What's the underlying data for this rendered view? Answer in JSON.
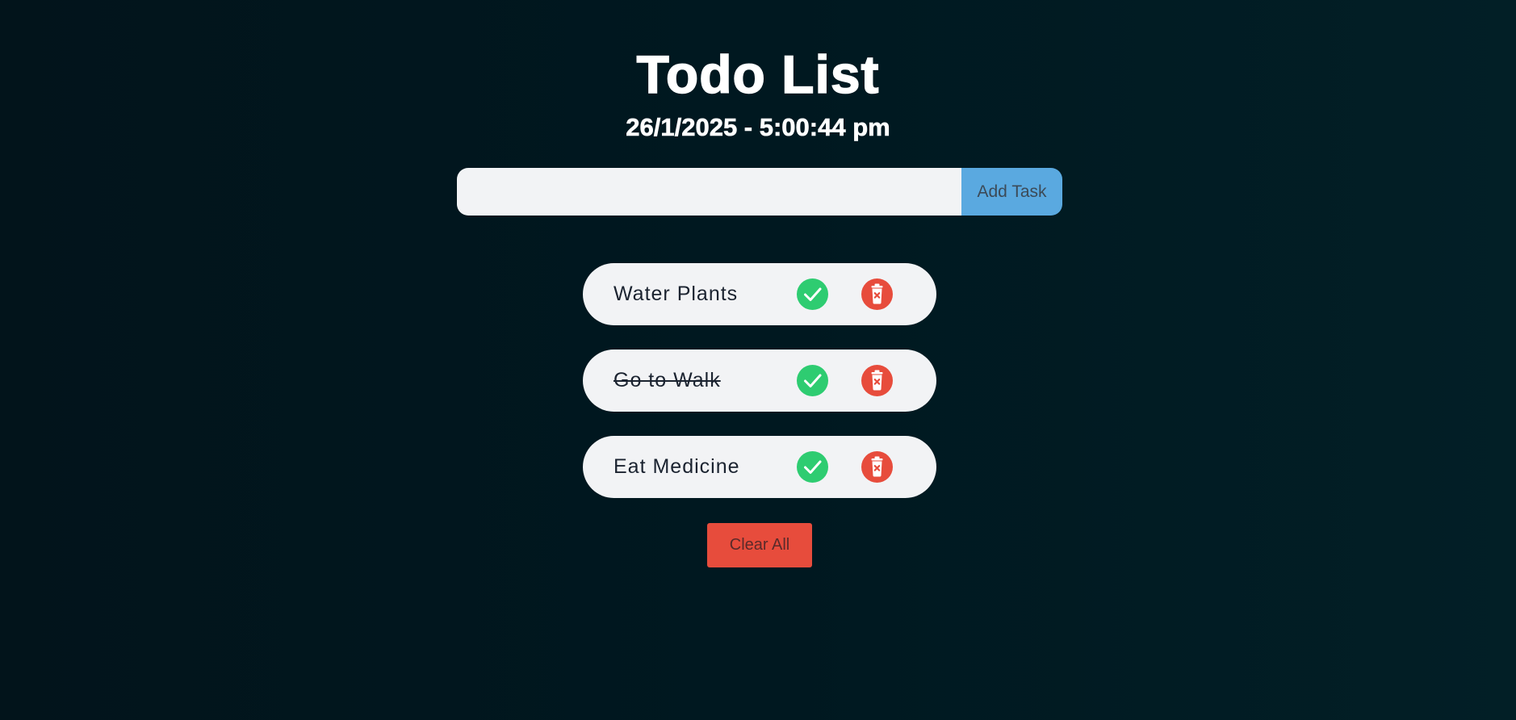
{
  "header": {
    "title": "Todo List",
    "datetime": "26/1/2025 - 5:00:44 pm"
  },
  "form": {
    "input_value": "",
    "input_placeholder": "",
    "add_label": "Add Task"
  },
  "tasks": [
    {
      "text": "Water Plants",
      "completed": false
    },
    {
      "text": "Go to Walk",
      "completed": true
    },
    {
      "text": "Eat Medicine",
      "completed": false
    }
  ],
  "actions": {
    "clear_label": "Clear All"
  },
  "icons": {
    "check": "check-circle-icon",
    "delete": "trash-x-icon"
  },
  "colors": {
    "background": "#001820",
    "add_button": "#5aa9e0",
    "check": "#2ecc71",
    "delete": "#e74c3c",
    "item_background": "#f2f3f5"
  }
}
